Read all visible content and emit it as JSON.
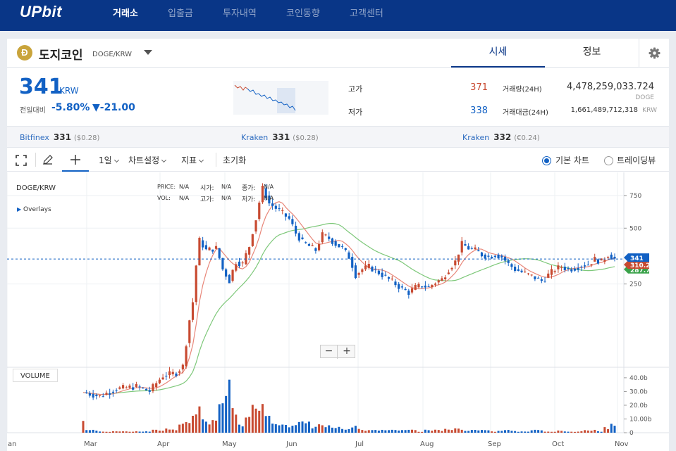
{
  "nav": {
    "logo": "UPbit",
    "items": [
      "거래소",
      "입출금",
      "투자내역",
      "코인동향",
      "고객센터"
    ]
  },
  "coin": {
    "logo_letter": "Ð",
    "name": "도지코인",
    "pair": "DOGE/KRW",
    "tabs": [
      "시세",
      "정보"
    ]
  },
  "price": {
    "value": "341",
    "unit": "KRW",
    "change_label": "전일대비",
    "change_pct": "-5.80%",
    "change_abs": "▼-21.00"
  },
  "stats": {
    "high_label": "고가",
    "high": "371",
    "low_label": "저가",
    "low": "338",
    "volume_label": "거래량(24H)",
    "volume": "4,478,259,033.724",
    "volume_unit": "DOGE",
    "amount_label": "거래대금(24H)",
    "amount": "1,661,489,712,318",
    "amount_unit": "KRW"
  },
  "exchanges": [
    {
      "name": "Bitfinex",
      "price": "331",
      "sub": "($0.28)"
    },
    {
      "name": "Kraken",
      "price": "331",
      "sub": "($0.28)"
    },
    {
      "name": "Kraken",
      "price": "332",
      "sub": "(€0.24)"
    }
  ],
  "toolbar": {
    "interval": "1일",
    "chart_settings": "차트설정",
    "indicators": "지표",
    "reset": "초기화",
    "basic_chart": "기본 차트",
    "tradingview": "트레이딩뷰"
  },
  "overlay": {
    "symbol": "DOGE/KRW",
    "overlays": "Overlays",
    "price_label": "PRICE:",
    "price_val": "N/A",
    "open_label": "시가:",
    "open_val": "N/A",
    "close_label": "종가:",
    "close_val": "N/A",
    "vol_label": "VOL:",
    "vol_val": "N/A",
    "high_label": "고가:",
    "high_val": "N/A",
    "low_label": "저가:",
    "low_val": "N/A",
    "volume_panel": "VOLUME",
    "zoom_out": "−",
    "zoom_in": "+"
  },
  "colors": {
    "up": "#c84a31",
    "down": "#1261c4",
    "ma_short": "#e8877a",
    "ma_long": "#7ec87a",
    "brand": "#093687"
  },
  "chart_data": {
    "type": "candlestick",
    "x_ticks": [
      "Jan",
      "Mar",
      "Apr",
      "May",
      "Jun",
      "Jul",
      "Aug",
      "Sep",
      "Oct",
      "Nov"
    ],
    "price_ticks": [
      750,
      500,
      250
    ],
    "volume_ticks": [
      "40.0b",
      "30.0b",
      "20.0b",
      "10.00b",
      "0"
    ],
    "price_range": [
      60,
      900
    ],
    "volume_range": [
      0,
      42
    ],
    "last_price": 341,
    "ma_short_last": "310.2",
    "ma_long_last": "287.73",
    "closes": [
      {
        "t": 0,
        "v": 65
      },
      {
        "t": 5,
        "v": 62
      },
      {
        "t": 10,
        "v": 68
      },
      {
        "t": 16,
        "v": 70
      },
      {
        "t": 20,
        "v": 66
      },
      {
        "t": 24,
        "v": 80
      },
      {
        "t": 28,
        "v": 83
      },
      {
        "t": 30,
        "v": 90
      },
      {
        "t": 31,
        "v": 120
      },
      {
        "t": 33,
        "v": 200
      },
      {
        "t": 35,
        "v": 430
      },
      {
        "t": 37,
        "v": 380
      },
      {
        "t": 40,
        "v": 390
      },
      {
        "t": 42,
        "v": 300
      },
      {
        "t": 44,
        "v": 260
      },
      {
        "t": 46,
        "v": 330
      },
      {
        "t": 48,
        "v": 320
      },
      {
        "t": 50,
        "v": 400
      },
      {
        "t": 52,
        "v": 560
      },
      {
        "t": 53,
        "v": 690
      },
      {
        "t": 54,
        "v": 820
      },
      {
        "t": 56,
        "v": 680
      },
      {
        "t": 58,
        "v": 640
      },
      {
        "t": 60,
        "v": 600
      },
      {
        "t": 62,
        "v": 560
      },
      {
        "t": 64,
        "v": 470
      },
      {
        "t": 66,
        "v": 420
      },
      {
        "t": 68,
        "v": 400
      },
      {
        "t": 70,
        "v": 380
      },
      {
        "t": 72,
        "v": 460
      },
      {
        "t": 74,
        "v": 440
      },
      {
        "t": 76,
        "v": 410
      },
      {
        "t": 78,
        "v": 390
      },
      {
        "t": 80,
        "v": 350
      },
      {
        "t": 82,
        "v": 280
      },
      {
        "t": 84,
        "v": 300
      },
      {
        "t": 86,
        "v": 310
      },
      {
        "t": 88,
        "v": 295
      },
      {
        "t": 90,
        "v": 280
      },
      {
        "t": 92,
        "v": 265
      },
      {
        "t": 94,
        "v": 250
      },
      {
        "t": 96,
        "v": 235
      },
      {
        "t": 98,
        "v": 225
      },
      {
        "t": 100,
        "v": 240
      },
      {
        "t": 102,
        "v": 245
      },
      {
        "t": 104,
        "v": 240
      },
      {
        "t": 106,
        "v": 255
      },
      {
        "t": 108,
        "v": 265
      },
      {
        "t": 110,
        "v": 300
      },
      {
        "t": 112,
        "v": 330
      },
      {
        "t": 114,
        "v": 410
      },
      {
        "t": 116,
        "v": 390
      },
      {
        "t": 118,
        "v": 380
      },
      {
        "t": 120,
        "v": 360
      },
      {
        "t": 122,
        "v": 350
      },
      {
        "t": 124,
        "v": 360
      },
      {
        "t": 126,
        "v": 350
      },
      {
        "t": 128,
        "v": 320
      },
      {
        "t": 130,
        "v": 300
      },
      {
        "t": 132,
        "v": 290
      },
      {
        "t": 134,
        "v": 280
      },
      {
        "t": 136,
        "v": 270
      },
      {
        "t": 138,
        "v": 260
      },
      {
        "t": 140,
        "v": 280
      },
      {
        "t": 142,
        "v": 300
      },
      {
        "t": 144,
        "v": 310
      },
      {
        "t": 146,
        "v": 300
      },
      {
        "t": 148,
        "v": 305
      },
      {
        "t": 150,
        "v": 315
      },
      {
        "t": 152,
        "v": 320
      },
      {
        "t": 154,
        "v": 340
      },
      {
        "t": 156,
        "v": 330
      },
      {
        "t": 158,
        "v": 360
      },
      {
        "t": 160,
        "v": 341
      }
    ],
    "volumes": [
      {
        "t": 0,
        "v": 8
      },
      {
        "t": 4,
        "v": 2
      },
      {
        "t": 8,
        "v": 1
      },
      {
        "t": 12,
        "v": 1
      },
      {
        "t": 16,
        "v": 1
      },
      {
        "t": 20,
        "v": 1
      },
      {
        "t": 24,
        "v": 2
      },
      {
        "t": 28,
        "v": 3
      },
      {
        "t": 30,
        "v": 6
      },
      {
        "t": 32,
        "v": 10
      },
      {
        "t": 34,
        "v": 14
      },
      {
        "t": 35,
        "v": 19
      },
      {
        "t": 36,
        "v": 11
      },
      {
        "t": 38,
        "v": 8
      },
      {
        "t": 40,
        "v": 9
      },
      {
        "t": 42,
        "v": 22
      },
      {
        "t": 44,
        "v": 43
      },
      {
        "t": 45,
        "v": 18
      },
      {
        "t": 46,
        "v": 12
      },
      {
        "t": 48,
        "v": 7
      },
      {
        "t": 50,
        "v": 14
      },
      {
        "t": 52,
        "v": 26
      },
      {
        "t": 53,
        "v": 22
      },
      {
        "t": 54,
        "v": 29
      },
      {
        "t": 56,
        "v": 18
      },
      {
        "t": 58,
        "v": 9
      },
      {
        "t": 60,
        "v": 7
      },
      {
        "t": 62,
        "v": 6
      },
      {
        "t": 64,
        "v": 8
      },
      {
        "t": 66,
        "v": 12
      },
      {
        "t": 68,
        "v": 9
      },
      {
        "t": 70,
        "v": 5
      },
      {
        "t": 72,
        "v": 6
      },
      {
        "t": 74,
        "v": 5
      },
      {
        "t": 76,
        "v": 4
      },
      {
        "t": 78,
        "v": 4
      },
      {
        "t": 80,
        "v": 3
      },
      {
        "t": 82,
        "v": 6
      },
      {
        "t": 84,
        "v": 3
      },
      {
        "t": 86,
        "v": 2
      },
      {
        "t": 88,
        "v": 2
      },
      {
        "t": 90,
        "v": 2
      },
      {
        "t": 92,
        "v": 2
      },
      {
        "t": 94,
        "v": 2
      },
      {
        "t": 96,
        "v": 2
      },
      {
        "t": 98,
        "v": 2
      },
      {
        "t": 100,
        "v": 2
      },
      {
        "t": 102,
        "v": 1
      },
      {
        "t": 104,
        "v": 2
      },
      {
        "t": 106,
        "v": 2
      },
      {
        "t": 108,
        "v": 2
      },
      {
        "t": 110,
        "v": 3
      },
      {
        "t": 112,
        "v": 3
      },
      {
        "t": 114,
        "v": 3
      },
      {
        "t": 116,
        "v": 2
      },
      {
        "t": 118,
        "v": 2
      },
      {
        "t": 120,
        "v": 2
      },
      {
        "t": 122,
        "v": 2
      },
      {
        "t": 124,
        "v": 1
      },
      {
        "t": 126,
        "v": 2
      },
      {
        "t": 128,
        "v": 2
      },
      {
        "t": 130,
        "v": 2
      },
      {
        "t": 132,
        "v": 1
      },
      {
        "t": 134,
        "v": 1
      },
      {
        "t": 136,
        "v": 2
      },
      {
        "t": 138,
        "v": 2
      },
      {
        "t": 140,
        "v": 1
      },
      {
        "t": 142,
        "v": 1
      },
      {
        "t": 144,
        "v": 2
      },
      {
        "t": 146,
        "v": 1
      },
      {
        "t": 148,
        "v": 1
      },
      {
        "t": 150,
        "v": 1
      },
      {
        "t": 152,
        "v": 2
      },
      {
        "t": 154,
        "v": 2
      },
      {
        "t": 156,
        "v": 1
      },
      {
        "t": 158,
        "v": 4
      },
      {
        "t": 160,
        "v": 8
      }
    ]
  }
}
